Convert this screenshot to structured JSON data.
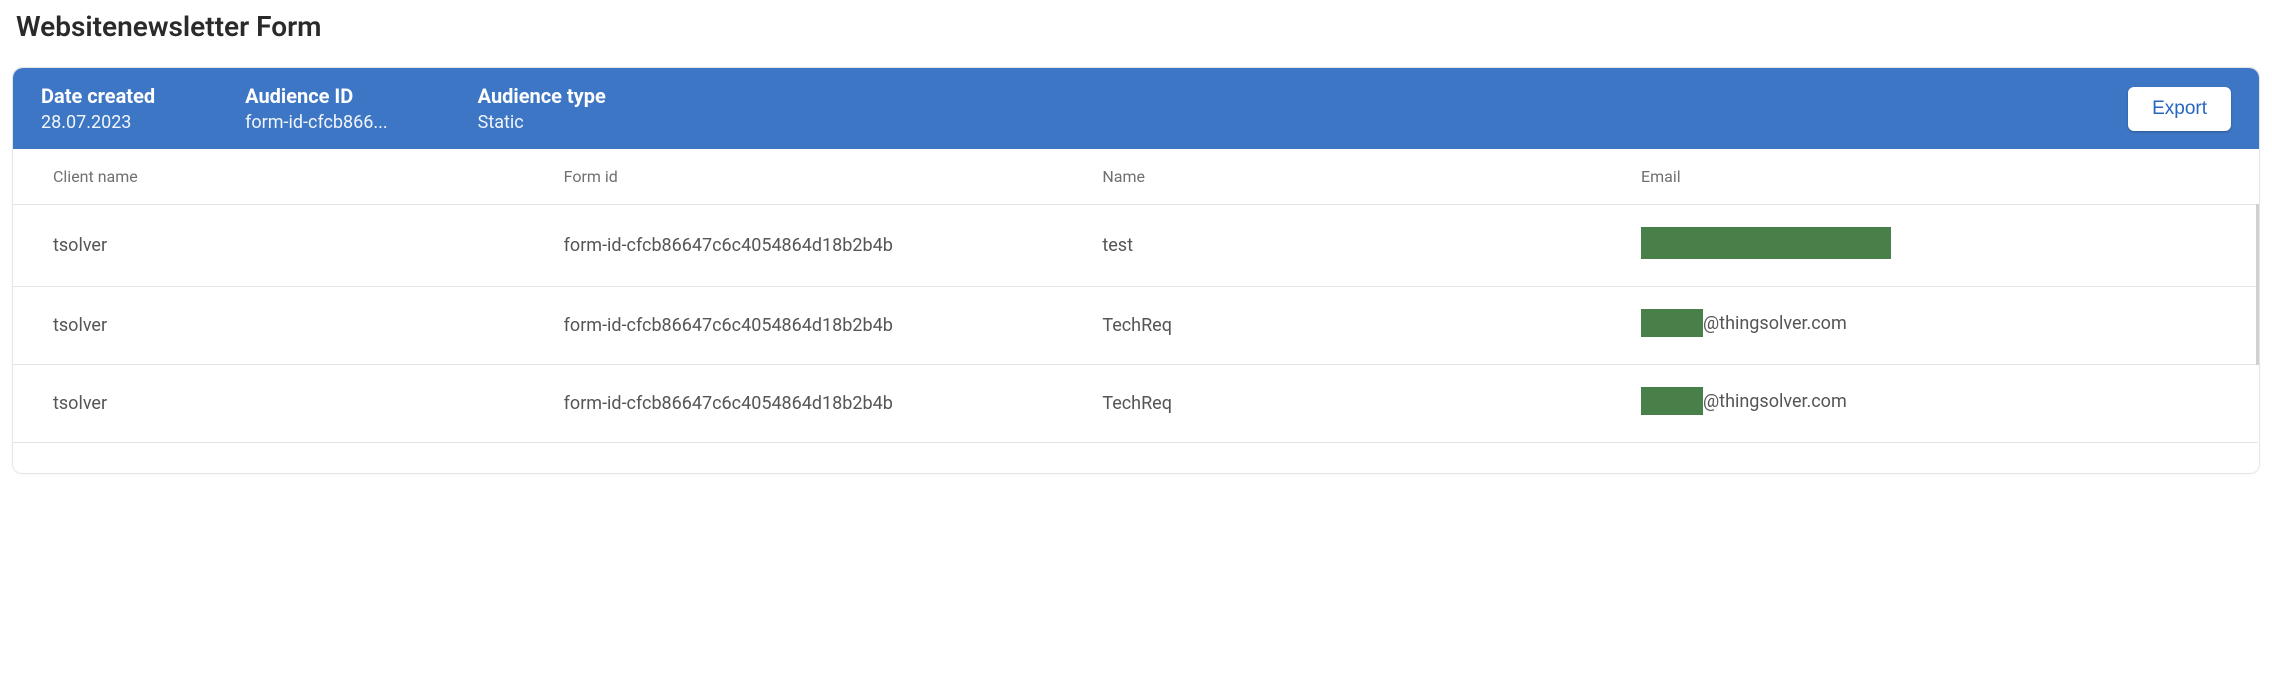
{
  "page": {
    "title": "Websitenewsletter Form"
  },
  "header": {
    "date_created_label": "Date created",
    "date_created_value": "28.07.2023",
    "audience_id_label": "Audience ID",
    "audience_id_value": "form-id-cfcb866...",
    "audience_type_label": "Audience type",
    "audience_type_value": "Static",
    "export_label": "Export"
  },
  "table": {
    "columns": {
      "client_name": "Client name",
      "form_id": "Form id",
      "name": "Name",
      "email": "Email"
    },
    "rows": [
      {
        "client_name": "tsolver",
        "form_id": "form-id-cfcb86647c6c4054864d18b2b4b",
        "name": "test",
        "email_redacted": true,
        "email_visible": ""
      },
      {
        "client_name": "tsolver",
        "form_id": "form-id-cfcb86647c6c4054864d18b2b4b",
        "name": "TechReq",
        "email_redacted": false,
        "email_visible": "@thingsolver.com"
      },
      {
        "client_name": "tsolver",
        "form_id": "form-id-cfcb86647c6c4054864d18b2b4b",
        "name": "TechReq",
        "email_redacted": false,
        "email_visible": "@thingsolver.com"
      }
    ]
  }
}
